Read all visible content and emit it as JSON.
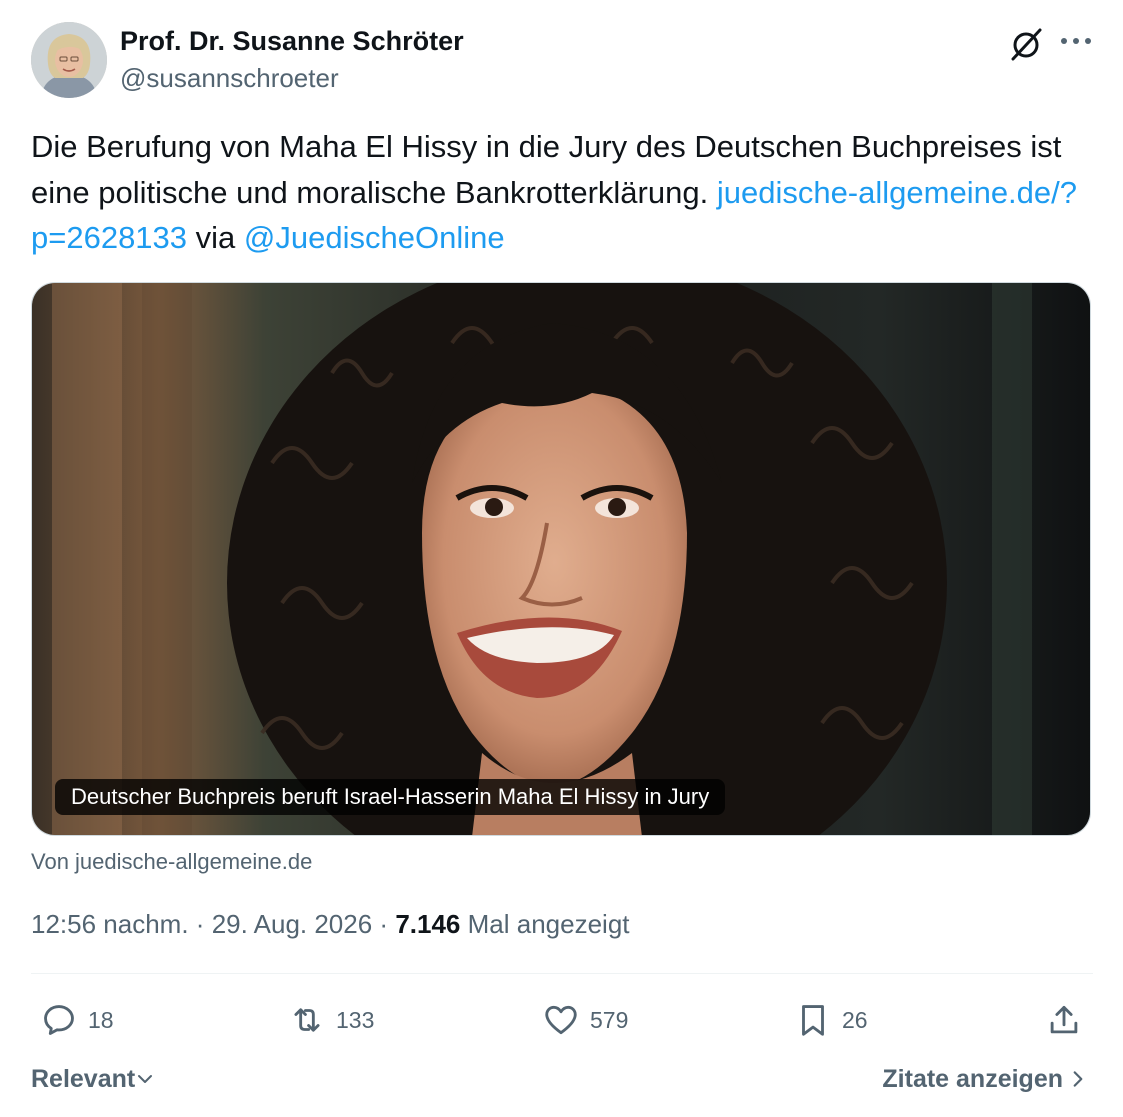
{
  "author": {
    "name": "Prof. Dr. Susanne Schröter",
    "handle": "@susannschroeter"
  },
  "tweet": {
    "text_main": "Die Berufung von Maha El Hissy in die Jury des Deutschen Buchpreises ist eine politische und moralische Bankrotterklärung.",
    "link_text": "juedische-allgemeine.de/?p=2628133",
    "via_text": "via",
    "mention": "@JuedischeOnline"
  },
  "card": {
    "caption": "Deutscher Buchpreis beruft Israel-Hasserin Maha El Hissy in Jury",
    "source": "Von juedische-allgemeine.de"
  },
  "meta": {
    "time": "12:56 nachm.",
    "separator": "·",
    "date": "29. Aug. 2026",
    "views_count": "7.146",
    "views_label": "Mal angezeigt"
  },
  "actions": {
    "replies": "18",
    "reposts": "133",
    "likes": "579",
    "bookmarks": "26"
  },
  "footer": {
    "sort_label": "Relevant",
    "quotes_label": "Zitate anzeigen"
  },
  "icons": [
    "grok-icon",
    "more-icon",
    "reply-icon",
    "repost-icon",
    "like-icon",
    "bookmark-icon",
    "share-icon",
    "chevron-down-icon",
    "chevron-right-icon"
  ],
  "colors": {
    "link": "#1d9bf0",
    "text": "#0f1419",
    "secondary": "#536471"
  }
}
